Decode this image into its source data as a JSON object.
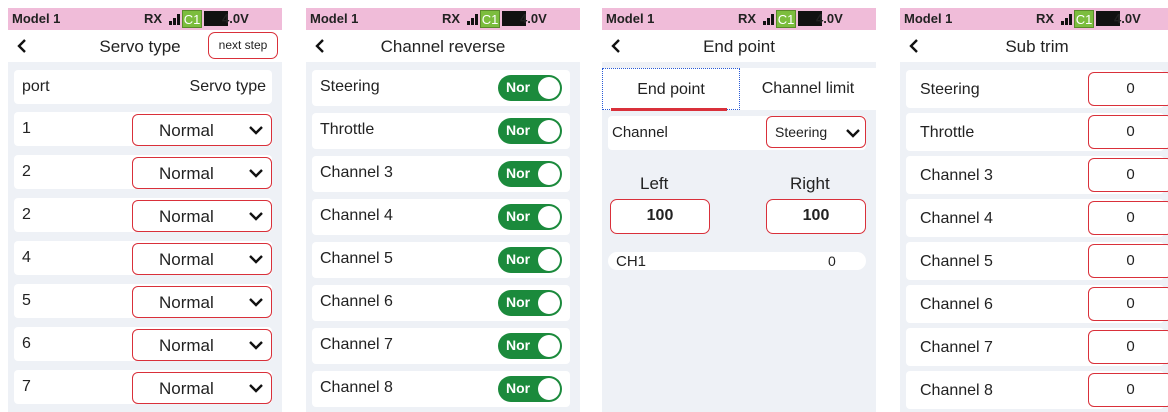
{
  "status": {
    "model": "Model 1",
    "rx": "RX",
    "channel_badge": "C1",
    "voltage": "4.0V"
  },
  "servo_type": {
    "title": "Servo type",
    "next_label": "next step",
    "header": {
      "port": "port",
      "type": "Servo type"
    },
    "rows": [
      {
        "port": "1",
        "type": "Normal"
      },
      {
        "port": "2",
        "type": "Normal"
      },
      {
        "port": "2",
        "type": "Normal"
      },
      {
        "port": "4",
        "type": "Normal"
      },
      {
        "port": "5",
        "type": "Normal"
      },
      {
        "port": "6",
        "type": "Normal"
      },
      {
        "port": "7",
        "type": "Normal"
      }
    ]
  },
  "channel_reverse": {
    "title": "Channel reverse",
    "rows": [
      {
        "name": "Steering",
        "state": "Nor"
      },
      {
        "name": "Throttle",
        "state": "Nor"
      },
      {
        "name": "Channel 3",
        "state": "Nor"
      },
      {
        "name": "Channel 4",
        "state": "Nor"
      },
      {
        "name": "Channel 5",
        "state": "Nor"
      },
      {
        "name": "Channel 6",
        "state": "Nor"
      },
      {
        "name": "Channel 7",
        "state": "Nor"
      },
      {
        "name": "Channel 8",
        "state": "Nor"
      }
    ]
  },
  "end_point": {
    "title": "End point",
    "tabs": [
      "End point",
      "Channel limit"
    ],
    "channel_label": "Channel",
    "channel_value": "Steering",
    "left_label": "Left",
    "right_label": "Right",
    "left_value": "100",
    "right_value": "100",
    "ch_name": "CH1",
    "ch_value": "0"
  },
  "sub_trim": {
    "title": "Sub trim",
    "rows": [
      {
        "name": "Steering",
        "value": "0"
      },
      {
        "name": "Throttle",
        "value": "0"
      },
      {
        "name": "Channel 3",
        "value": "0"
      },
      {
        "name": "Channel 4",
        "value": "0"
      },
      {
        "name": "Channel 5",
        "value": "0"
      },
      {
        "name": "Channel 6",
        "value": "0"
      },
      {
        "name": "Channel 7",
        "value": "0"
      },
      {
        "name": "Channel 8",
        "value": "0"
      }
    ]
  }
}
